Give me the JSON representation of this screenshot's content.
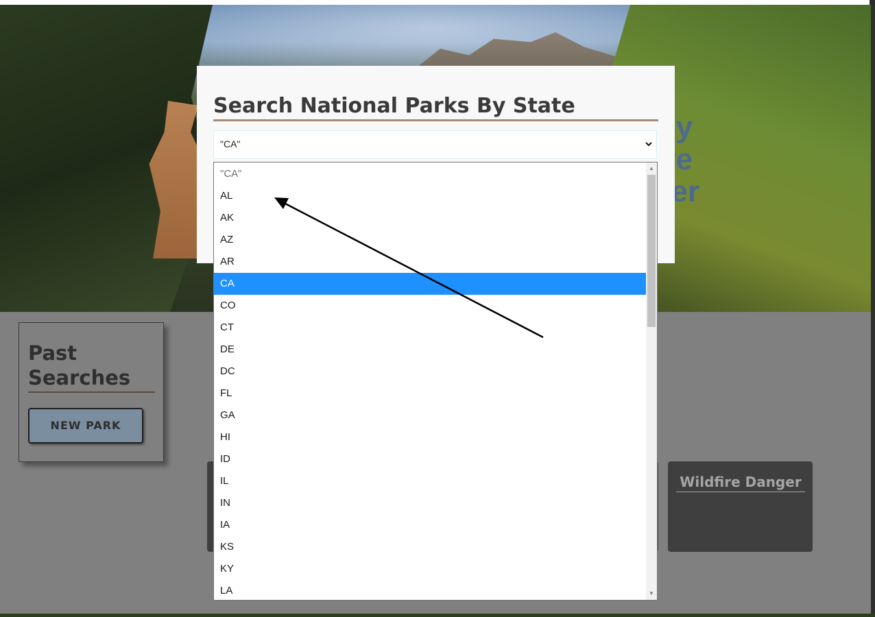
{
  "hero": {
    "title_lines": [
      "Daily",
      "l Fire",
      "acker"
    ]
  },
  "modal": {
    "title": "Search National Parks By State",
    "select_value": "\"CA\""
  },
  "dropdown": {
    "options": [
      "\"CA\"",
      "AL",
      "AK",
      "AZ",
      "AR",
      "CA",
      "CO",
      "CT",
      "DE",
      "DC",
      "FL",
      "GA",
      "HI",
      "ID",
      "IL",
      "IN",
      "IA",
      "KS",
      "KY",
      "LA"
    ],
    "selected": "CA",
    "highlight_color": "#1e90ff"
  },
  "past_searches": {
    "title": "Past Searches",
    "new_park_label": "NEW PARK"
  },
  "wildfire": {
    "title": "Wildfire Danger"
  },
  "icons": {
    "select_chevron": "chevron-down-icon",
    "annotation": "arrow-annotation"
  }
}
